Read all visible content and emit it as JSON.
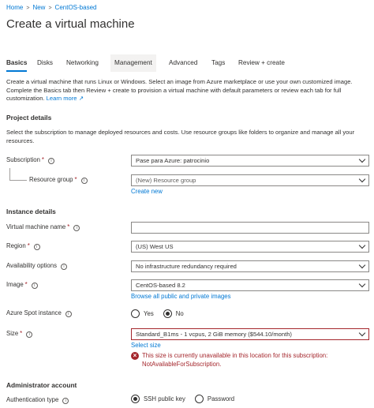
{
  "breadcrumb": {
    "home": "Home",
    "new": "New",
    "item": "CentOS-based",
    "separator": ">"
  },
  "page": {
    "title": "Create a virtual machine"
  },
  "tabs": [
    {
      "label": "Basics"
    },
    {
      "label": "Disks"
    },
    {
      "label": "Networking"
    },
    {
      "label": "Management"
    },
    {
      "label": "Advanced"
    },
    {
      "label": "Tags"
    },
    {
      "label": "Review + create"
    }
  ],
  "intro": {
    "text": "Create a virtual machine that runs Linux or Windows. Select an image from Azure marketplace or use your own customized image. Complete the Basics tab then Review + create to provision a virtual machine with default parameters or review each tab for full customization.",
    "link": "Learn more"
  },
  "project": {
    "heading": "Project details",
    "description": "Select the subscription to manage deployed resources and costs. Use resource groups like folders to organize and manage all your resources.",
    "subscription_label": "Subscription",
    "subscription_value": "Pase para Azure: patrocinio",
    "resource_group_label": "Resource group",
    "resource_group_value": "(New) Resource group",
    "create_new": "Create new"
  },
  "instance": {
    "heading": "Instance details",
    "vm_name_label": "Virtual machine name",
    "vm_name_value": "",
    "region_label": "Region",
    "region_value": "(US) West US",
    "availability_label": "Availability options",
    "availability_value": "No infrastructure redundancy required",
    "image_label": "Image",
    "image_value": "CentOS-based 8.2",
    "browse_images": "Browse all public and private images",
    "spot_label": "Azure Spot instance",
    "spot_yes": "Yes",
    "spot_no": "No",
    "size_label": "Size",
    "size_value": "Standard_B1ms - 1 vcpus, 2 GiB memory ($544.10/month)",
    "select_size": "Select size",
    "size_error": "This size is currently unavailable in this location for this subscription: NotAvailableForSubscription."
  },
  "admin": {
    "heading": "Administrator account",
    "auth_label": "Authentication type",
    "auth_ssh": "SSH public key",
    "auth_password": "Password"
  },
  "required_mark": "*",
  "info_glyph": "i",
  "error_glyph": "×",
  "colors": {
    "accent": "#0078d4",
    "error": "#a4262c",
    "text": "#323130"
  }
}
